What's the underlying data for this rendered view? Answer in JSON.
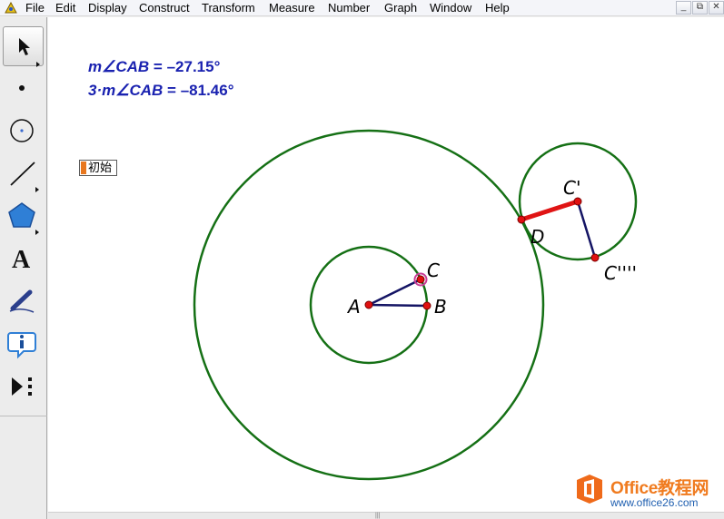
{
  "menu": {
    "items": [
      "File",
      "Edit",
      "Display",
      "Construct",
      "Transform",
      "Measure",
      "Number",
      "Graph",
      "Window",
      "Help"
    ],
    "window_controls": [
      "_",
      "⧉",
      "✕"
    ]
  },
  "toolbox": {
    "tools": [
      "arrow-select-tool",
      "point-tool",
      "compass-tool",
      "straightedge-tool",
      "polygon-tool",
      "text-tool",
      "marker-tool",
      "information-tool",
      "custom-tool"
    ],
    "selected": "arrow-select-tool"
  },
  "measurements": [
    {
      "prefix": "m∠",
      "name": "CAB",
      "eq": " = –27.15°"
    },
    {
      "prefix": "3·m∠",
      "name": "CAB",
      "eq": " = –81.46°"
    }
  ],
  "action_button": {
    "label": "初始"
  },
  "points": {
    "A": "A",
    "B": "B",
    "C": "C",
    "D": "D",
    "C_prime": "C'",
    "C_quad_prime": "C''''"
  },
  "colors": {
    "circle": "#157015",
    "segment": "#141464",
    "highlight_segment": "#e01414",
    "point": "#e01010",
    "measurement_text": "#1a22b0"
  },
  "watermark": {
    "title": "Office教程网",
    "url": "www.office26.com"
  }
}
